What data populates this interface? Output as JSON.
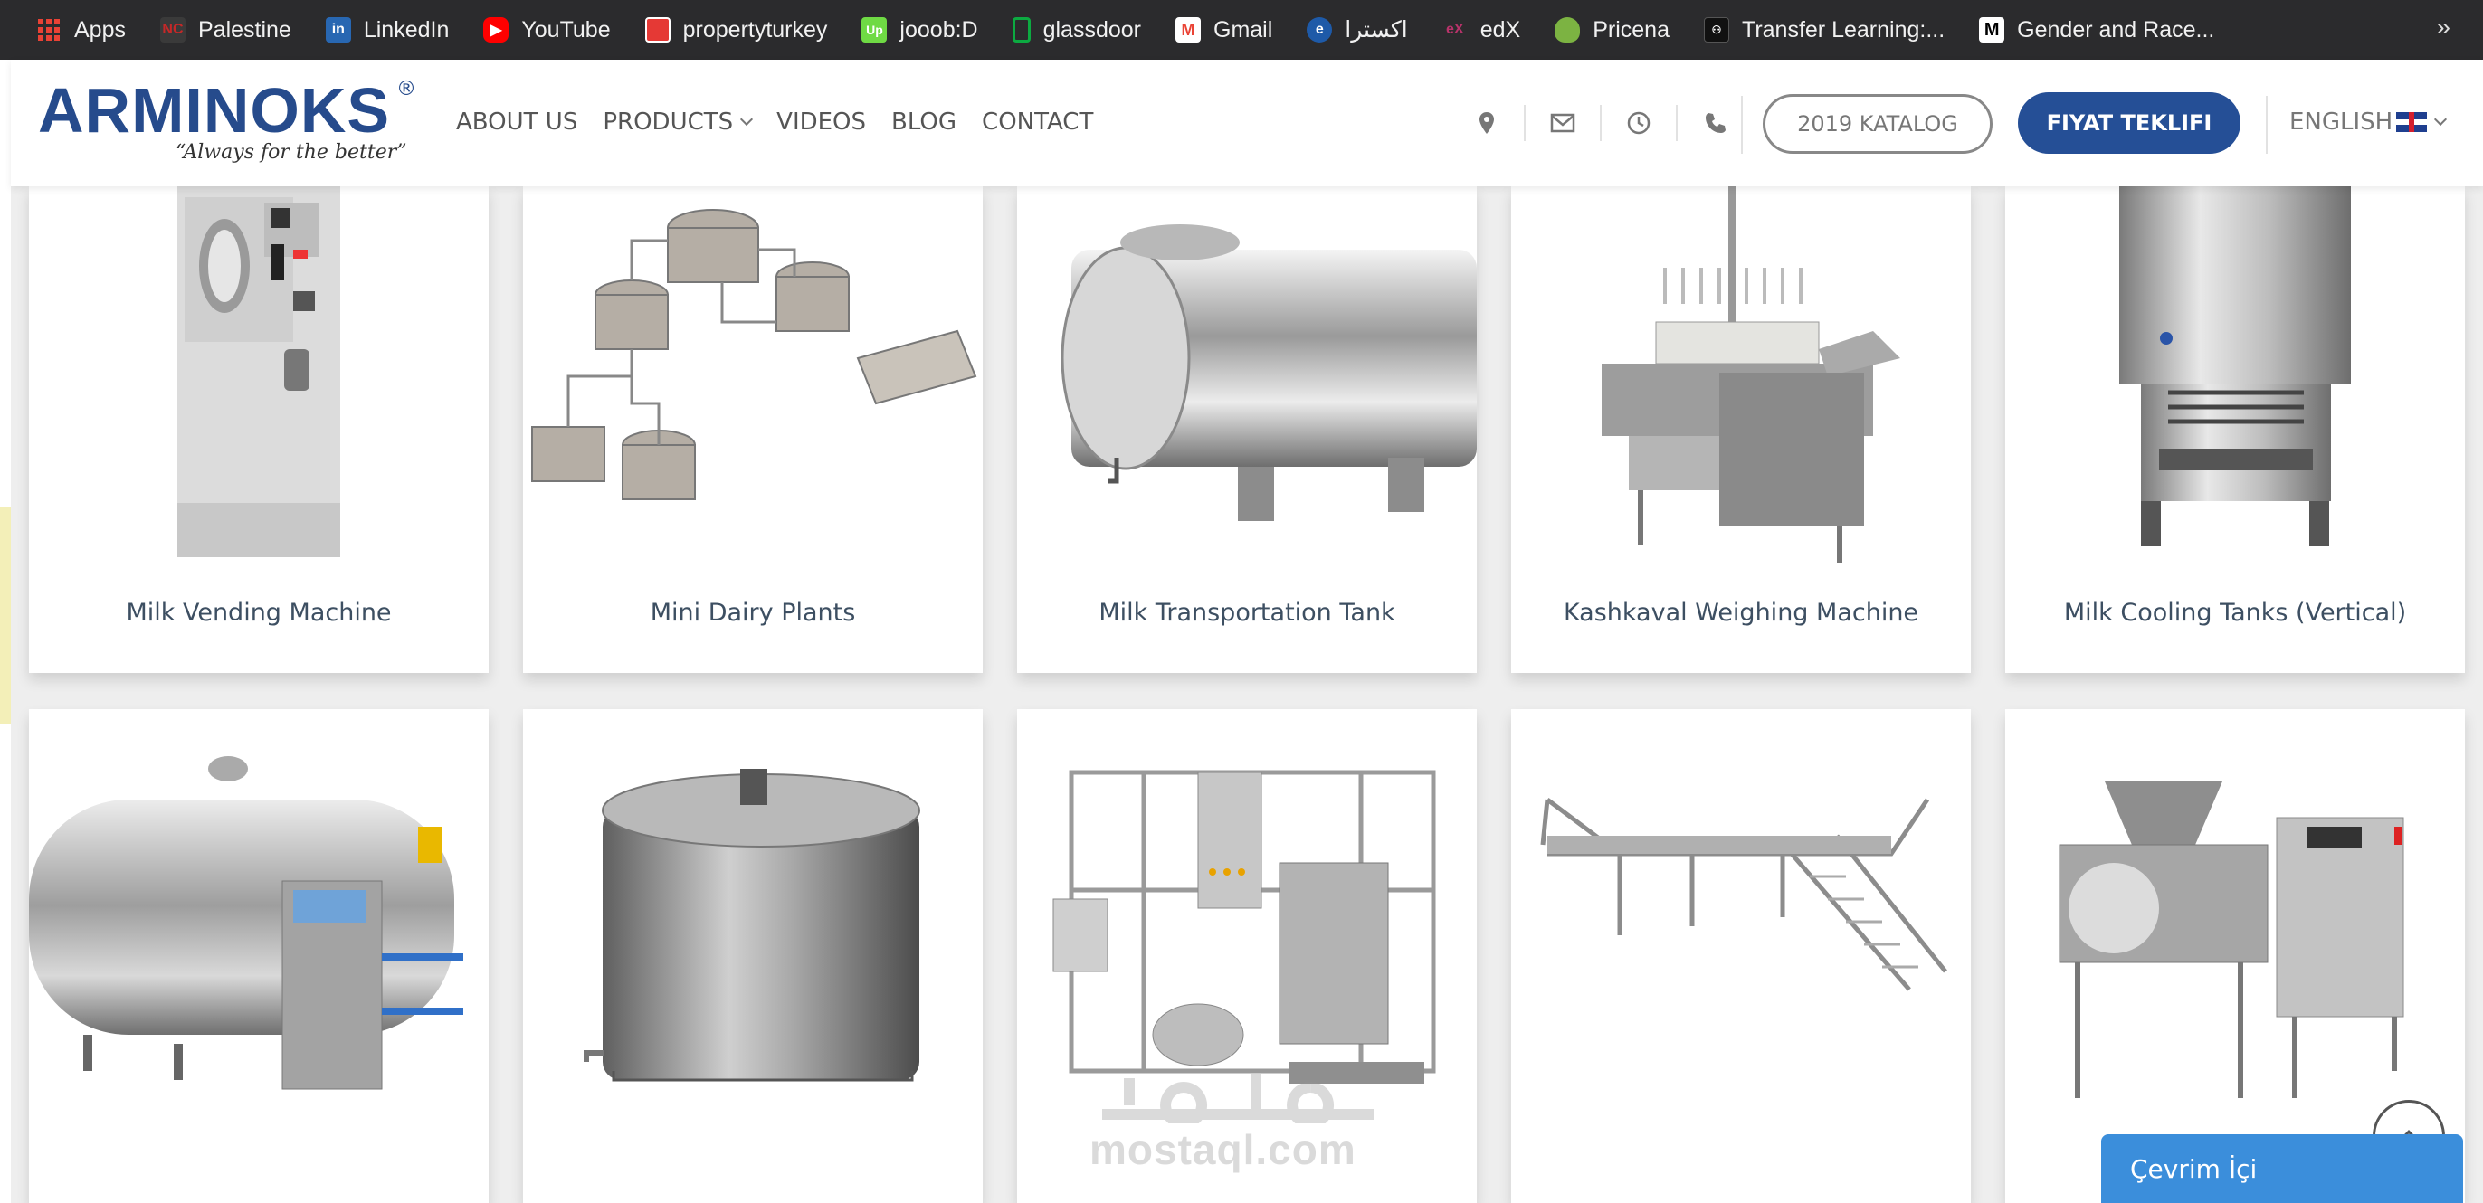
{
  "bookmarks": [
    {
      "label": "Apps",
      "icon": "apps-grid-icon",
      "color": "#e94235"
    },
    {
      "label": "Palestine",
      "icon": "palestine-site-icon",
      "color": "#c62828"
    },
    {
      "label": "LinkedIn",
      "icon": "linkedin-icon",
      "color": "#2867b2"
    },
    {
      "label": "YouTube",
      "icon": "youtube-icon",
      "color": "#ff0000"
    },
    {
      "label": "propertyturkey",
      "icon": "propertyturkey-icon",
      "color": "#e53935"
    },
    {
      "label": "jooob:D",
      "icon": "upwork-icon",
      "color": "#6fda44"
    },
    {
      "label": "glassdoor",
      "icon": "glassdoor-icon",
      "color": "#0caa41"
    },
    {
      "label": "Gmail",
      "icon": "gmail-icon",
      "color": "#ea4335"
    },
    {
      "label": "اكسترا",
      "icon": "extra-site-icon",
      "color": "#1e5aa8"
    },
    {
      "label": "edX",
      "icon": "edx-icon",
      "color": "#b8336a"
    },
    {
      "label": "Pricena",
      "icon": "pricena-icon",
      "color": "#7cb342"
    },
    {
      "label": "Transfer Learning:...",
      "icon": "transfer-learning-icon",
      "color": "#111111"
    },
    {
      "label": "Gender and Race...",
      "icon": "medium-icon",
      "color": "#000000"
    }
  ],
  "bookmarks_more": "»",
  "header": {
    "logo_text": "ARMINOKS",
    "logo_reg": "®",
    "logo_tagline": "“Always for the better”",
    "nav": [
      {
        "label": "ABOUT US"
      },
      {
        "label": "PRODUCTS"
      },
      {
        "label": "VIDEOS"
      },
      {
        "label": "BLOG"
      },
      {
        "label": "CONTACT"
      }
    ],
    "katalog_label": "2019 KATALOG",
    "fiyat_label": "FIYAT TEKLIFI",
    "language_label": "ENGLISH",
    "brand_color": "#254f96"
  },
  "products": [
    {
      "title": "Milk Vending Machine"
    },
    {
      "title": "Mini Dairy Plants"
    },
    {
      "title": "Milk Transportation Tank"
    },
    {
      "title": "Kashkaval Weighing Machine"
    },
    {
      "title": "Milk Cooling Tanks (Vertical)"
    },
    {
      "title": ""
    },
    {
      "title": ""
    },
    {
      "title": ""
    },
    {
      "title": ""
    },
    {
      "title": ""
    }
  ],
  "watermark": "mostaql.com",
  "chat_label": "Çevrim İçi"
}
